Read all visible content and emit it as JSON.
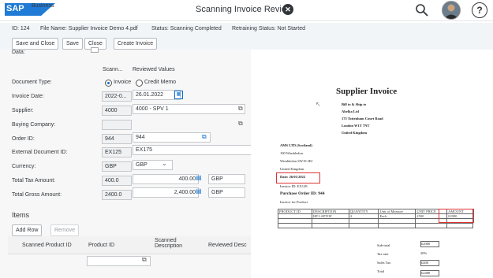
{
  "app": {
    "logo_text": "SAP",
    "logo_sub": "Business",
    "title": "Scanning Invoice Review"
  },
  "header": {
    "id": "ID: 124",
    "file_name": "File Name: Supplier Invoice Demo 4.pdf",
    "status": "Status: Scanning Completed",
    "retraining_status": "Retraining Status: Not Started"
  },
  "toolbar": {
    "save_close": "Save and Close",
    "save": "Save",
    "close": "Close",
    "create_invoice": "Create Invoice"
  },
  "form": {
    "data_label": "Data:",
    "col_scanned": "Scann...",
    "col_reviewed": "Reviewed Values",
    "rows": {
      "doc_type": {
        "label": "Document Type:",
        "opt1": "Invoice",
        "opt2": "Credit Memo"
      },
      "invoice_date": {
        "label": "Invoice Date:",
        "scanned": "2022-0...",
        "reviewed": "26.01.2022"
      },
      "supplier": {
        "label": "Supplier:",
        "scanned": "4000",
        "reviewed": "4000 - SPV 1"
      },
      "buying_company": {
        "label": "Buying Company:",
        "scanned": "",
        "reviewed": ""
      },
      "order_id": {
        "label": "Order ID:",
        "scanned": "944",
        "reviewed": "944"
      },
      "ext_doc_id": {
        "label": "External Document ID:",
        "scanned": "EX125",
        "reviewed": "EX175"
      },
      "currency": {
        "label": "Currency:",
        "scanned": "GBP",
        "reviewed": "GBP"
      },
      "total_tax": {
        "label": "Total Tax Amount:",
        "scanned": "400.0",
        "reviewed": "400.00",
        "currency": "GBP"
      },
      "total_gross": {
        "label": "Total Gross Amount:",
        "scanned": "2400.0",
        "reviewed": "2,400.00",
        "currency": "GBP"
      }
    },
    "items_title": "Items",
    "add_row": "Add Row",
    "remove": "Remove",
    "items_columns": [
      "Scanned Product ID",
      "Product ID",
      "Scanned Description",
      "Reviewed Desc"
    ]
  },
  "document": {
    "title": "Supplier Invoice",
    "bill_ship": [
      "Bill to & Ship to",
      "Abelka Ltd",
      "175 Tottenham Court Road",
      "London W1T 7NT",
      "United Kingdom"
    ],
    "supplier_block": [
      "AMS LTD (Scotland)",
      "100 Wimbledon",
      "Wimbledon SW19 2EJ",
      "United Kingdom"
    ],
    "date_line": "Date: 26/01/2022",
    "invoice_line": "Invoice ID: EX128",
    "po_line": "Purchase Order ID: 944",
    "invoice_for": "Invoice for Product",
    "table_header": [
      "PRODUCT ID",
      "DESCRIPTION",
      "QUANTITY",
      "Unit of Measure",
      "UNIT PRICE",
      "AMOUNT"
    ],
    "table_row": [
      "",
      "HP LAPTOP",
      "4",
      "Each",
      "£500",
      "£2000"
    ],
    "summary": [
      {
        "label": "Sub-total",
        "value": "£2000"
      },
      {
        "label": "Tax rate",
        "value": "20%"
      },
      {
        "label": "Sales Tax",
        "value": "£400"
      },
      {
        "label": "Total",
        "value": "£2400"
      }
    ]
  }
}
